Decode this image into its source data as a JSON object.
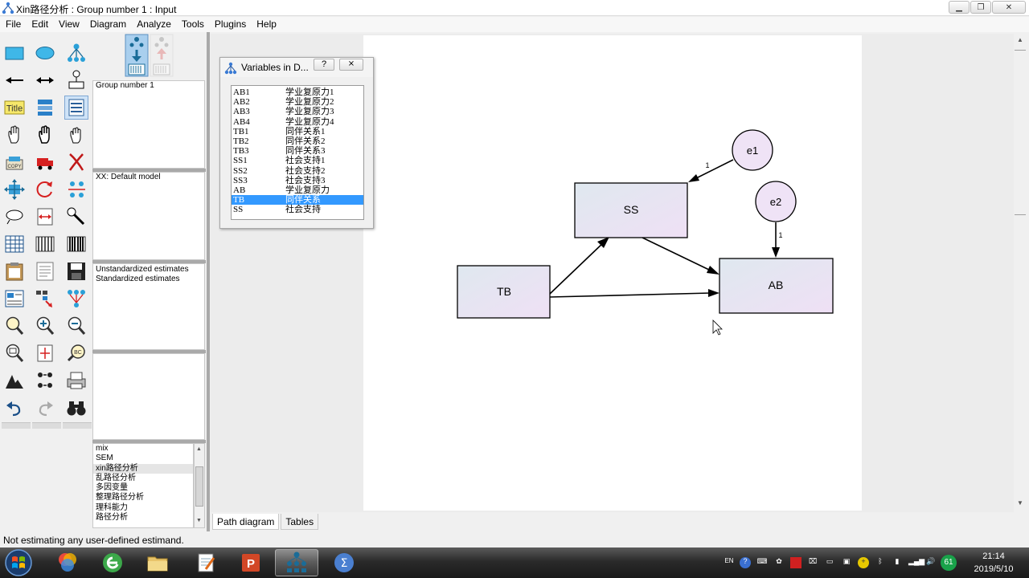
{
  "window": {
    "title": "Xin路径分析 : Group number 1 : Input",
    "controls": [
      "minimize",
      "restore",
      "close"
    ]
  },
  "menu": [
    "File",
    "Edit",
    "View",
    "Diagram",
    "Analyze",
    "Tools",
    "Plugins",
    "Help"
  ],
  "toolbar_icons": [
    "draw-observed-variable-icon",
    "draw-unobserved-variable-icon",
    "draw-latent-indicator-icon",
    "draw-path-icon",
    "draw-covariance-icon",
    "add-unique-variable-icon",
    "figure-caption-icon",
    "list-variables-in-model-icon",
    "list-variables-in-dataset-icon",
    "select-one-object-icon",
    "select-all-objects-icon",
    "deselect-all-objects-icon",
    "duplicate-objects-icon",
    "move-objects-icon",
    "erase-objects-icon",
    "change-shape-icon",
    "rotate-indicators-icon",
    "reflect-indicators-icon",
    "move-parameter-values-icon",
    "reposition-diagram-icon",
    "touch-up-variable-icon",
    "select-data-files-icon",
    "analysis-properties-icon",
    "calculate-estimates-icon",
    "copy-to-clipboard-icon",
    "view-text-icon",
    "save-diagram-icon",
    "object-properties-icon",
    "drag-properties-icon",
    "preserve-symmetries-icon",
    "zoom-in-area-icon",
    "zoom-in-icon",
    "zoom-out-icon",
    "show-page-icon",
    "resize-diagram-icon",
    "magnify-icon",
    "degrees-of-freedom-icon",
    "multiple-group-icon",
    "print-icon",
    "undo-icon",
    "redo-icon",
    "specification-search-icon"
  ],
  "panels": {
    "groups": [
      "Group number 1"
    ],
    "models": [
      "XX: Default model"
    ],
    "estimates": [
      "Unstandardized estimates",
      "Standardized estimates"
    ],
    "files": [
      "mix",
      "SEM",
      "xin路径分析",
      "乱路径分析",
      "多因变量",
      "整理路径分析",
      "理科能力",
      "路径分析"
    ],
    "selected_file": "xin路径分析"
  },
  "variables_dialog": {
    "title": "Variables in D...",
    "help_label": "?",
    "close_label": "⨯",
    "variables": [
      {
        "name": "AB1",
        "label": "学业复原力1"
      },
      {
        "name": "AB2",
        "label": "学业复原力2"
      },
      {
        "name": "AB3",
        "label": "学业复原力3"
      },
      {
        "name": "AB4",
        "label": "学业复原力4"
      },
      {
        "name": "TB1",
        "label": "同伴关系1"
      },
      {
        "name": "TB2",
        "label": "同伴关系2"
      },
      {
        "name": "TB3",
        "label": "同伴关系3"
      },
      {
        "name": "SS1",
        "label": "社会支持1"
      },
      {
        "name": "SS2",
        "label": "社会支持2"
      },
      {
        "name": "SS3",
        "label": "社会支持3"
      },
      {
        "name": "AB",
        "label": "学业复原力"
      },
      {
        "name": "TB",
        "label": "同伴关系"
      },
      {
        "name": "SS",
        "label": "社会支持"
      }
    ],
    "selected_variable": "TB"
  },
  "diagram": {
    "observed": [
      {
        "id": "SS",
        "label": "SS"
      },
      {
        "id": "TB",
        "label": "TB"
      },
      {
        "id": "AB",
        "label": "AB"
      }
    ],
    "errors": [
      {
        "id": "e1",
        "label": "e1",
        "target": "SS",
        "weight": "1"
      },
      {
        "id": "e2",
        "label": "e2",
        "target": "AB",
        "weight": "1"
      }
    ],
    "paths": [
      {
        "from": "TB",
        "to": "SS"
      },
      {
        "from": "TB",
        "to": "AB"
      },
      {
        "from": "SS",
        "to": "AB"
      }
    ],
    "box_fill_start": "#dfe8ef",
    "box_fill_end": "#efe0f5",
    "circle_fill": "#efe3f6"
  },
  "tabs": [
    {
      "label": "Path diagram",
      "active": true
    },
    {
      "label": "Tables",
      "active": false
    }
  ],
  "status": "Not estimating any user-defined estimand.",
  "taskbar": {
    "apps": [
      "start-button",
      "ie-browser",
      "file-explorer",
      "notepad",
      "powerpoint",
      "amos-graphics",
      "amos-sigma"
    ],
    "active_app": "amos-graphics",
    "tray": {
      "language": "EN",
      "help": "?",
      "badge": "61"
    },
    "clock": {
      "time": "21:14",
      "date": "2019/5/10"
    }
  }
}
